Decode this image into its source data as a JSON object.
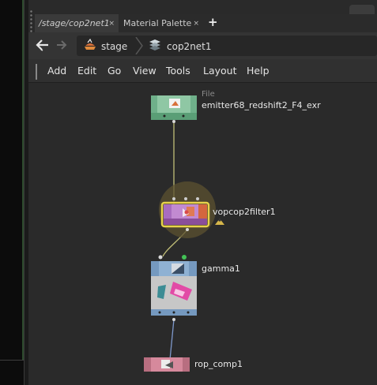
{
  "tabs": [
    {
      "label": "/stage/cop2net1",
      "active": true
    },
    {
      "label": "Material Palette",
      "active": false
    }
  ],
  "tab_close": "×",
  "add_tab": "+",
  "breadcrumb": [
    {
      "label": "stage",
      "icon": "stage-icon"
    },
    {
      "label": "cop2net1",
      "icon": "cop-network-icon"
    }
  ],
  "menu": [
    "Add",
    "Edit",
    "Go",
    "View",
    "Tools",
    "Layout",
    "Help"
  ],
  "nodes": {
    "file": {
      "type_label": "File",
      "name": "emitter68_redshift2_F4_exr",
      "color": "#8fc7a4"
    },
    "filter": {
      "name": "vopcop2filter1",
      "color": "#c28ad1",
      "selected_outline": "#e8d24a"
    },
    "gamma": {
      "name": "gamma1",
      "color": "#8fb1d3"
    },
    "rop": {
      "name": "rop_comp1",
      "color": "#d6899c"
    }
  },
  "colors": {
    "wire_yellow": "#c2bf78",
    "wire_blue": "#7d97c9",
    "flag_green": "#43c256"
  }
}
